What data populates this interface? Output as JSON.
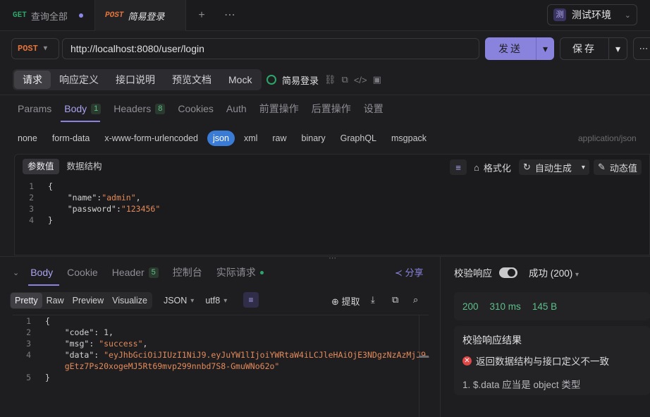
{
  "tabs": [
    {
      "method": "GET",
      "title": "查询全部"
    },
    {
      "method": "POST",
      "title": "简易登录"
    }
  ],
  "environment": {
    "badge": "测",
    "name": "测试环境"
  },
  "request": {
    "method": "POST",
    "url": "http://localhost:8080/user/login",
    "send_label": "发送",
    "save_label": "保存"
  },
  "subtabs": [
    "请求",
    "响应定义",
    "接口说明",
    "预览文档",
    "Mock"
  ],
  "api_name": "简易登录",
  "param_tabs": [
    {
      "label": "Params"
    },
    {
      "label": "Body",
      "count": "1"
    },
    {
      "label": "Headers",
      "count": "8"
    },
    {
      "label": "Cookies"
    },
    {
      "label": "Auth"
    },
    {
      "label": "前置操作"
    },
    {
      "label": "后置操作"
    },
    {
      "label": "设置"
    }
  ],
  "body_types": [
    "none",
    "form-data",
    "x-www-form-urlencoded",
    "json",
    "xml",
    "raw",
    "binary",
    "GraphQL",
    "msgpack"
  ],
  "content_type": "application/json",
  "editor": {
    "tabs": [
      "参数值",
      "数据结构"
    ],
    "tools": {
      "format": "格式化",
      "auto": "自动生成",
      "dynamic": "动态值"
    },
    "lines": [
      {
        "no": "1",
        "text": "{"
      },
      {
        "no": "2",
        "key": "\"name\"",
        "value": "\"admin\"",
        "tail": ","
      },
      {
        "no": "3",
        "key": "\"password\"",
        "value": "\"123456\"",
        "tail": ""
      },
      {
        "no": "4",
        "text": "}"
      }
    ]
  },
  "response": {
    "tabs": [
      {
        "label": "Body"
      },
      {
        "label": "Cookie"
      },
      {
        "label": "Header",
        "count": "5"
      },
      {
        "label": "控制台"
      },
      {
        "label": "实际请求"
      }
    ],
    "share_label": "分享",
    "formats": [
      "Pretty",
      "Raw",
      "Preview",
      "Visualize"
    ],
    "lang": "JSON",
    "encoding": "utf8",
    "extract_label": "提取",
    "lines": [
      {
        "no": "1",
        "text": "{"
      },
      {
        "no": "2",
        "key": "\"code\"",
        "value": "1",
        "tail": ","
      },
      {
        "no": "3",
        "key": "\"msg\"",
        "value": "\"success\"",
        "tail": ","
      },
      {
        "no": "4",
        "key": "\"data\"",
        "value": "\"eyJhbGciOiJIUzI1NiJ9.eyJuYW1lIjoiYWRtaW4iLCJleHAiOjE3NDgzNzAzMjJ9.",
        "value2": "gEtz7Ps20xogeMJ5Rt69mvp299nnbd7S8-GmuWNo62o\""
      },
      {
        "no": "5",
        "text": "}"
      }
    ]
  },
  "validation": {
    "label": "校验响应",
    "status": "成功 (200)",
    "code": "200",
    "time": "310 ms",
    "size": "145 B",
    "result_title": "校验响应结果",
    "error": "返回数据结构与接口定义不一致",
    "detail": "1. $.data 应当是 object 类型"
  },
  "colors": {
    "accent": "#8a83dd",
    "post": "#e2743b",
    "get": "#2ea56b",
    "success": "#5dc08a",
    "error": "#e04848"
  }
}
